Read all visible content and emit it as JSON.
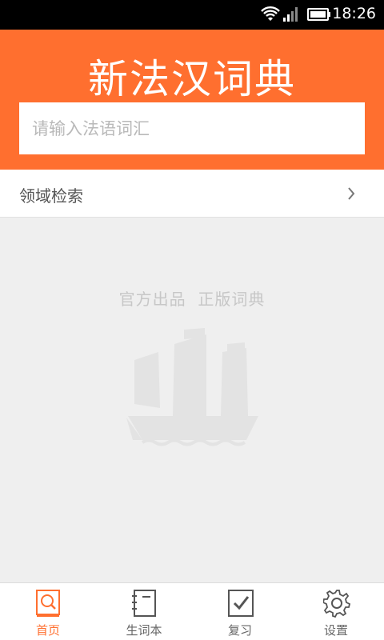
{
  "status": {
    "time": "18:26",
    "icons": [
      "wifi-icon",
      "signal-icon",
      "battery-icon"
    ]
  },
  "header": {
    "title": "新法汉词典",
    "search_placeholder": "请输入法语词汇",
    "search_value": ""
  },
  "domain_search": {
    "label": "领域检索"
  },
  "main": {
    "slogan": "官方出品  正版词典",
    "illustration": "ship-icon"
  },
  "bottom_nav": {
    "items": [
      {
        "label": "首页",
        "icon": "dictionary-search-icon",
        "active": true
      },
      {
        "label": "生词本",
        "icon": "notebook-icon",
        "active": false
      },
      {
        "label": "复习",
        "icon": "checkbox-icon",
        "active": false
      },
      {
        "label": "设置",
        "icon": "gear-icon",
        "active": false
      }
    ]
  },
  "colors": {
    "brand": "#ff6f2f",
    "background": "#efefef",
    "muted_text": "#c7c7c7"
  }
}
